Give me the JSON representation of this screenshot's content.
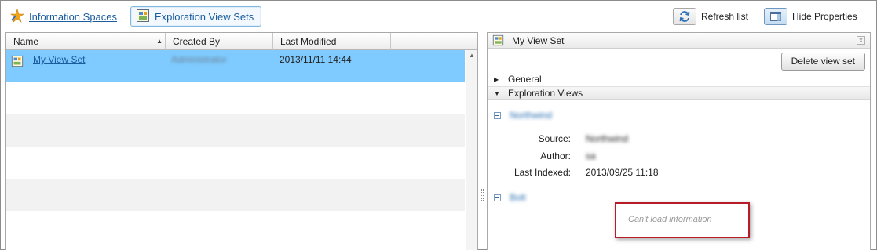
{
  "toolbar": {
    "info_spaces_label": "Information Spaces",
    "view_sets_label": "Exploration View Sets",
    "refresh_label": "Refresh list",
    "hide_props_label": "Hide Properties"
  },
  "list": {
    "columns": [
      "Name",
      "Created By",
      "Last Modified"
    ],
    "rows": [
      {
        "name": "My View Set",
        "created_by": "Administrator",
        "last_modified": "2013/11/11 14:44",
        "selected": true
      }
    ]
  },
  "properties": {
    "title": "My View Set",
    "close_glyph": "x",
    "delete_label": "Delete view set",
    "general_label": "General",
    "views_label": "Exploration Views",
    "views": [
      {
        "name": "Northwind",
        "source_label": "Source:",
        "source_value": "Northwind",
        "author_label": "Author:",
        "author_value": "sa",
        "indexed_label": "Last Indexed:",
        "indexed_value": "2013/09/25 11:18"
      },
      {
        "name": "Bolt"
      }
    ],
    "error_text": "Can't load information"
  },
  "colors": {
    "selection": "#7fcbff",
    "link": "#1a5c9e",
    "error_border": "#b81c28"
  },
  "icons": [
    "star-icon",
    "view-set-icon",
    "refresh-icon",
    "properties-panel-icon",
    "close-icon",
    "expand-icon",
    "collapse-icon",
    "minus-box-icon",
    "sort-ascending-icon",
    "scroll-up-icon"
  ]
}
